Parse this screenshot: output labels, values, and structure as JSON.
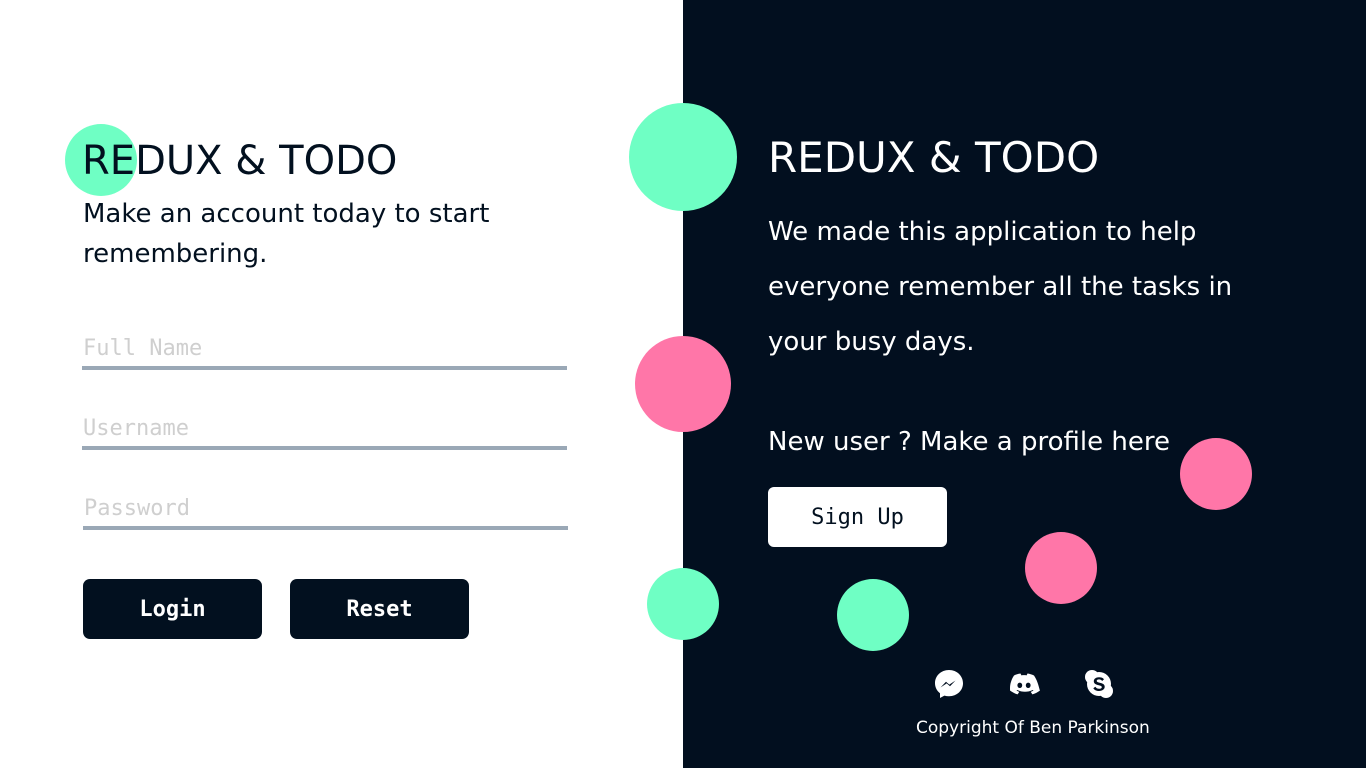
{
  "login": {
    "title": "REDUX & TODO",
    "tagline": "Make an account today to start remembering.",
    "fields": {
      "full_name": {
        "placeholder": "Full Name",
        "value": ""
      },
      "username": {
        "placeholder": "Username",
        "value": ""
      },
      "password": {
        "placeholder": "Password",
        "value": ""
      }
    },
    "login_label": "Login",
    "reset_label": "Reset"
  },
  "info": {
    "title": "REDUX & TODO",
    "description": "We made this application to help everyone remember all the tasks in your busy days.",
    "new_user_text": "New user ? Make a profile here",
    "signup_label": "Sign Up",
    "social_icons": [
      "messenger-icon",
      "discord-icon",
      "skype-icon"
    ],
    "copyright": "Copyright Of Ben Parkinson"
  },
  "colors": {
    "dark": "#020f1f",
    "green_accent": "#6fffc4",
    "pink_accent": "#ff76a8",
    "input_underline": "#9aa8b6"
  }
}
